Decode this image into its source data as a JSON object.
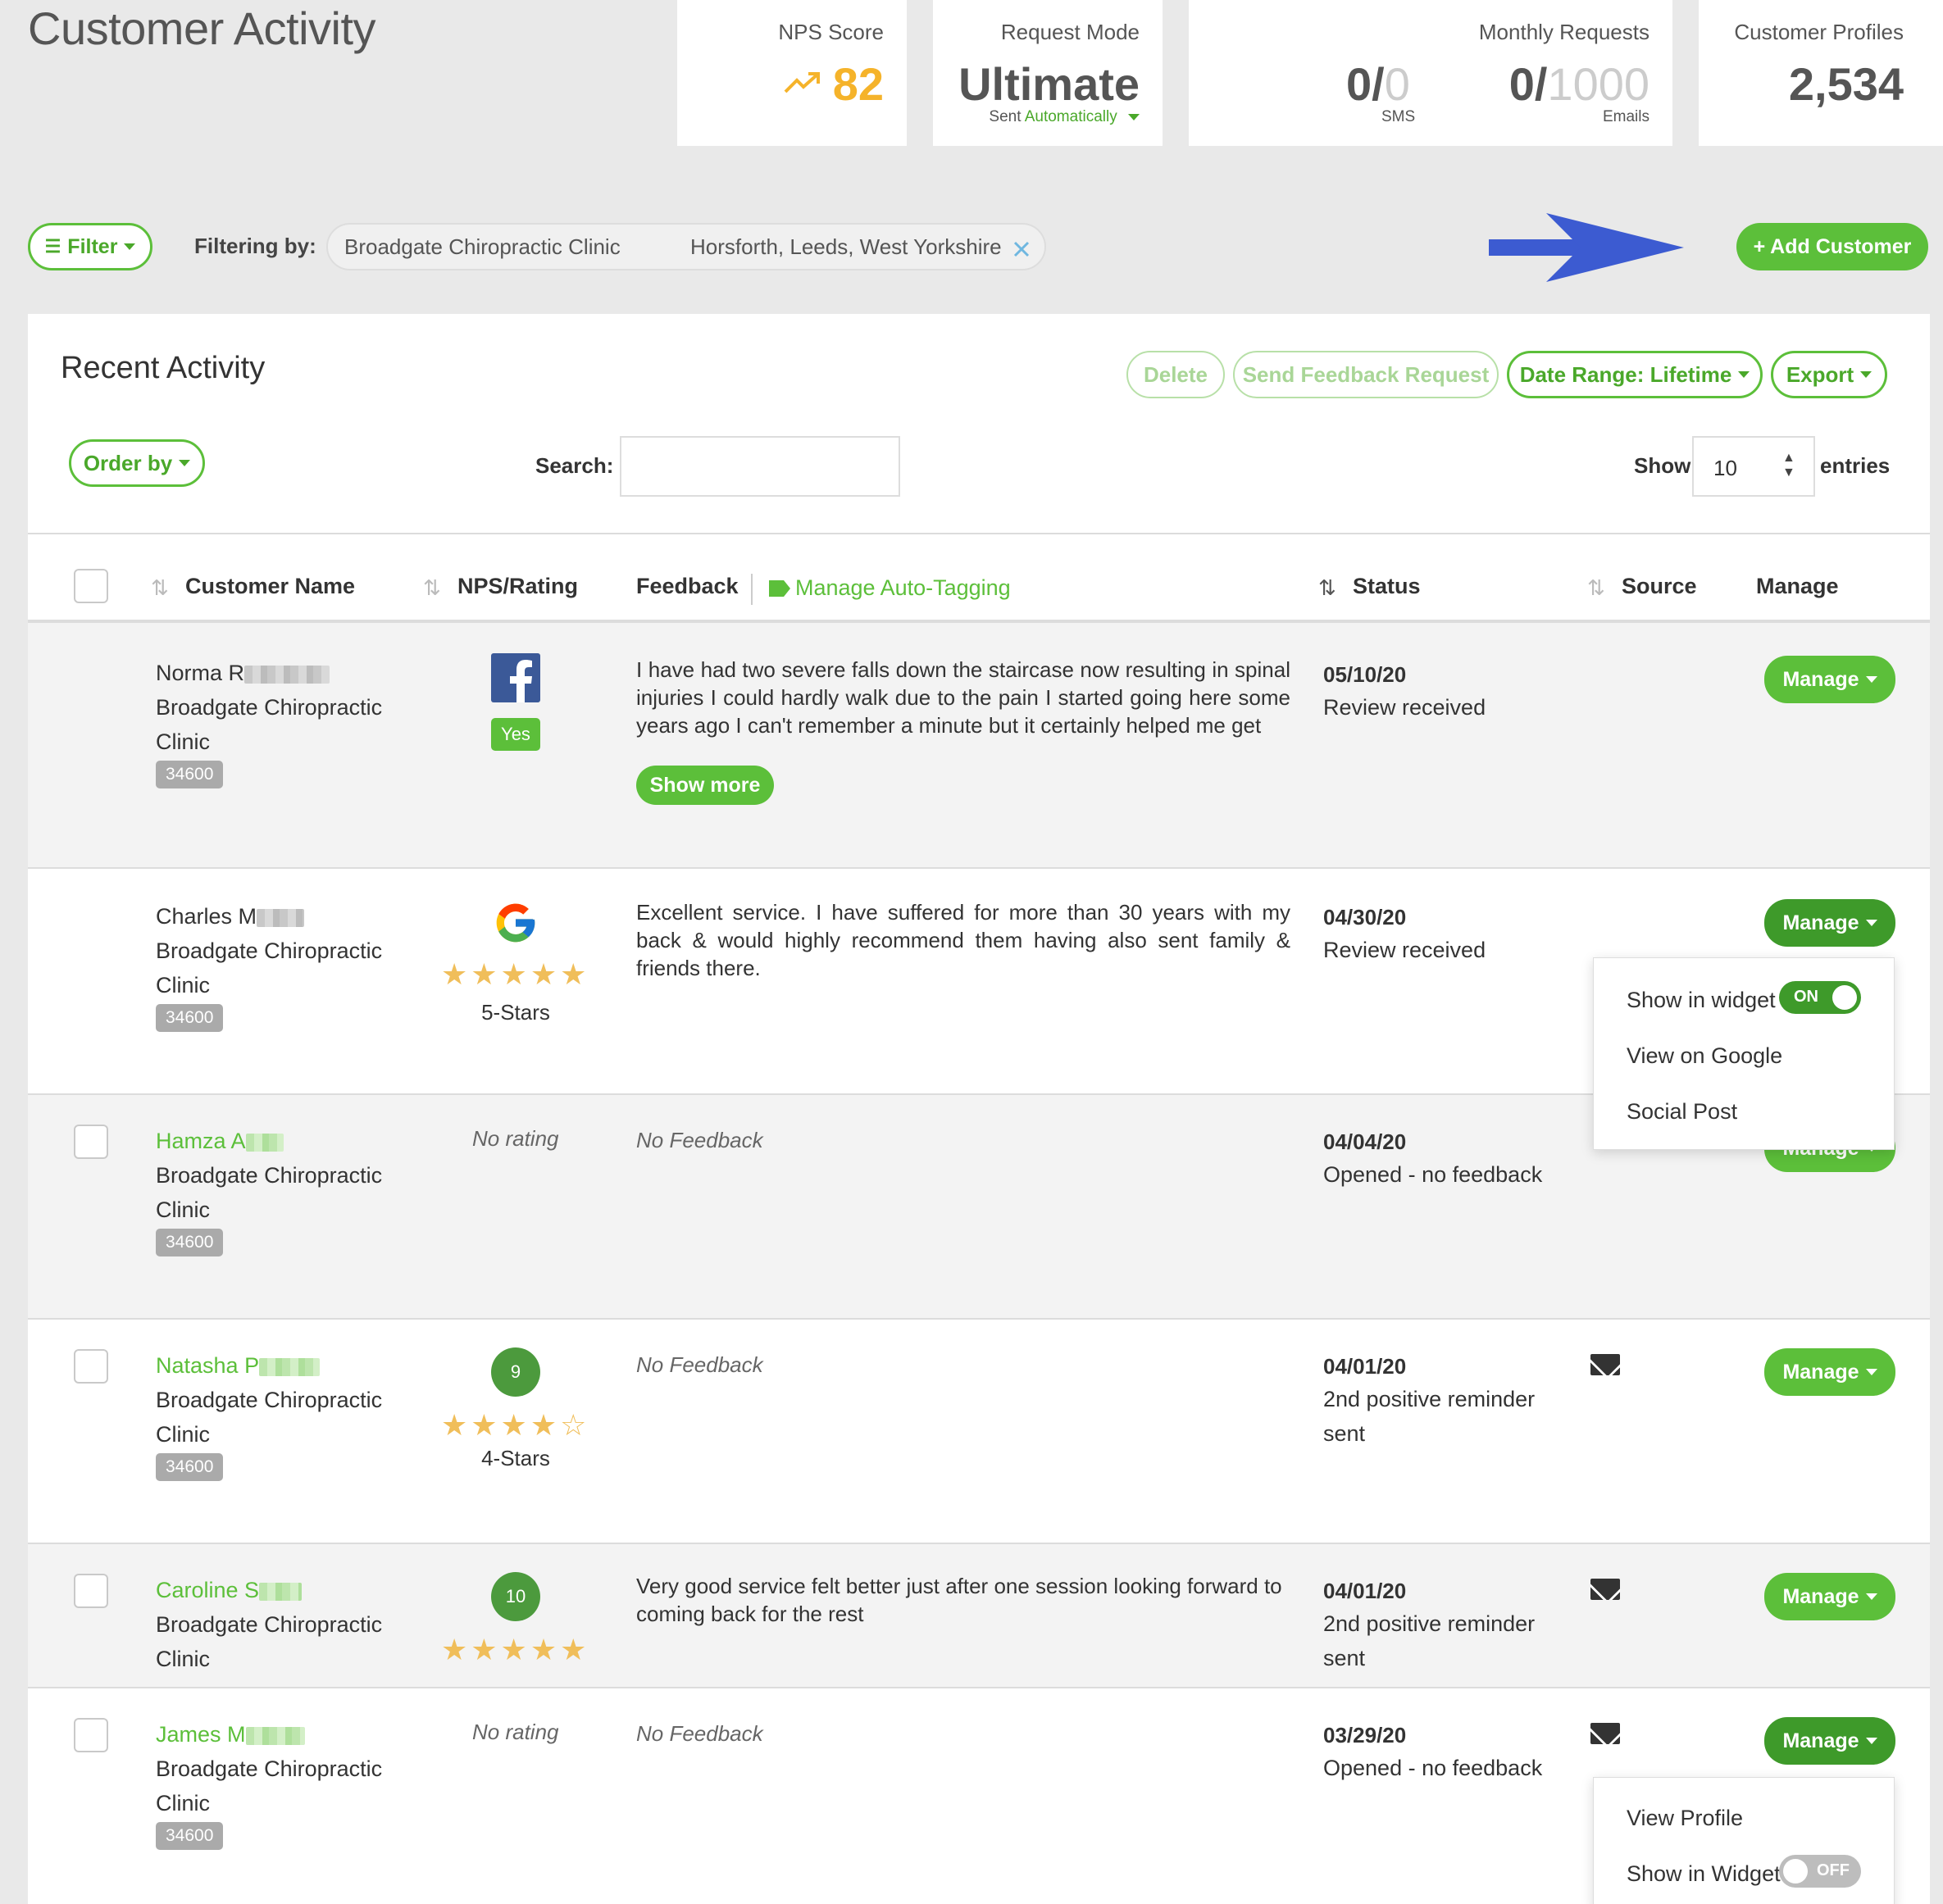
{
  "page": {
    "title": "Customer Activity"
  },
  "stats": {
    "nps": {
      "label": "NPS Score",
      "value": "82"
    },
    "request_mode": {
      "label": "Request Mode",
      "value": "Ultimate",
      "sent_prefix": "Sent",
      "sent_mode": "Automatically"
    },
    "monthly": {
      "label": "Monthly Requests",
      "sms_used": "0",
      "sms_limit": "0",
      "sms_label": "SMS",
      "email_used": "0",
      "email_limit": "1000",
      "email_label": "Emails"
    },
    "profiles": {
      "label": "Customer Profiles",
      "value": "2,534"
    }
  },
  "filterbar": {
    "filter_label": "Filter",
    "filtering_by": "Filtering by:",
    "chip_clinic": "Broadgate Chiropractic Clinic",
    "chip_location": "Horsforth, Leeds, West Yorkshire",
    "add_customer": "+ Add Customer"
  },
  "activity": {
    "title": "Recent Activity",
    "delete": "Delete",
    "send_feedback": "Send Feedback Request",
    "date_range": "Date Range: Lifetime",
    "export": "Export",
    "order_by": "Order by",
    "search_label": "Search:",
    "search_value": "",
    "show_label": "Show",
    "show_value": "10",
    "entries_label": "entries"
  },
  "columns": {
    "customer_name": "Customer Name",
    "nps_rating": "NPS/Rating",
    "feedback": "Feedback",
    "manage_tagging": "Manage Auto-Tagging",
    "status": "Status",
    "source": "Source",
    "manage": "Manage"
  },
  "rows": [
    {
      "name": "Norma R",
      "clinic": "Broadgate Chiropractic Clinic",
      "id": "34600",
      "rating_source": "facebook",
      "rating_badge": "Yes",
      "feedback": "I have had two severe falls down the staircase now resulting in spinal injuries I could hardly walk due to the pain I started going here some years ago I can't remember a minute but it certainly helped me get",
      "show_more": "Show more",
      "date": "05/10/20",
      "status": "Review received",
      "manage": "Manage"
    },
    {
      "name": "Charles M",
      "clinic": "Broadgate Chiropractic Clinic",
      "id": "34600",
      "rating_source": "google",
      "stars": 5,
      "stars_label": "5-Stars",
      "feedback": "Excellent service. I have suffered for more than 30 years with my back & would highly recommend them having also sent family & friends there.",
      "date": "04/30/20",
      "status": "Review received",
      "manage": "Manage"
    },
    {
      "name": "Hamza A",
      "clinic": "Broadgate Chiropractic Clinic",
      "id": "34600",
      "rating_text": "No rating",
      "feedback": "No Feedback",
      "date": "04/04/20",
      "status": "Opened - no feedback",
      "manage": "Manage"
    },
    {
      "name": "Natasha P",
      "clinic": "Broadgate Chiropractic Clinic",
      "id": "34600",
      "nps": "9",
      "stars": 4,
      "stars_label": "4-Stars",
      "feedback": "No Feedback",
      "date": "04/01/20",
      "status": "2nd positive reminder sent",
      "manage": "Manage"
    },
    {
      "name": "Caroline S",
      "clinic": "Broadgate Chiropractic Clinic",
      "nps": "10",
      "stars": 5,
      "feedback": "Very good service felt better just after one session looking forward to coming back for the rest",
      "date": "04/01/20",
      "status": "2nd positive reminder sent",
      "manage": "Manage"
    },
    {
      "name": "James M",
      "clinic": "Broadgate Chiropractic Clinic",
      "id": "34600",
      "rating_text": "No rating",
      "feedback": "No Feedback",
      "date": "03/29/20",
      "status": "Opened - no feedback",
      "manage": "Manage"
    }
  ],
  "dropdown1": {
    "show_in_widget": "Show in widget",
    "toggle": "ON",
    "view_google": "View on Google",
    "social_post": "Social Post"
  },
  "dropdown2": {
    "view_profile": "View Profile",
    "show_in_widget": "Show in Widget",
    "toggle": "OFF"
  },
  "colors": {
    "brand_green": "#5cbf3a",
    "dark_green": "#3e9a2a",
    "nps_orange": "#f5b32a",
    "arrow_blue": "#3c5bd1",
    "star": "#f0be5a"
  },
  "icons": {
    "trend": "trending-up-icon",
    "filter": "sliders-icon",
    "close": "close-icon",
    "tag": "tag-icon",
    "sort": "sort-icon",
    "facebook": "facebook-icon",
    "google": "google-icon",
    "mail": "envelope-icon"
  }
}
